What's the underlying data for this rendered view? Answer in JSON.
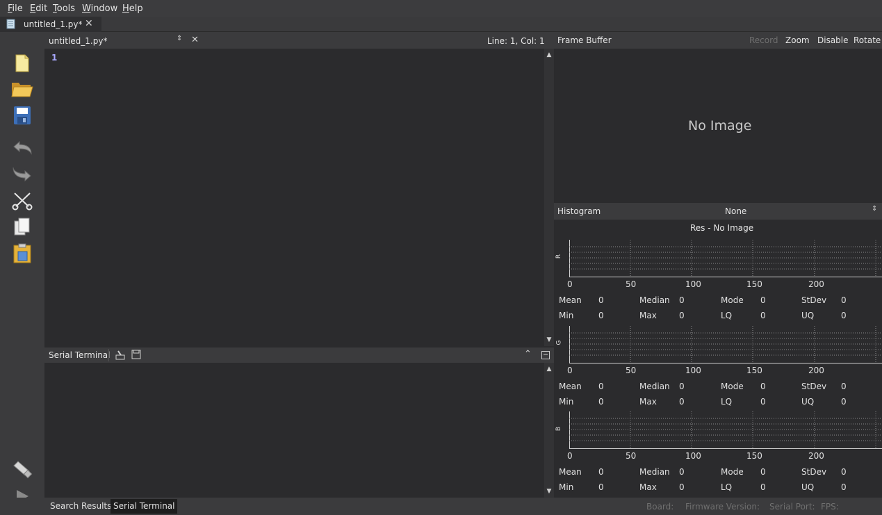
{
  "menu": [
    "File",
    "Edit",
    "Tools",
    "Window",
    "Help"
  ],
  "tab": {
    "title": "untitled_1.py*"
  },
  "editor": {
    "file_selector": "untitled_1.py*",
    "cursor_pos": "Line: 1, Col: 1",
    "line_numbers": [
      "1"
    ]
  },
  "toolbar": {
    "icons": [
      "new-file-icon",
      "open-folder-icon",
      "save-icon",
      "undo-icon",
      "redo-icon",
      "cut-icon",
      "copy-icon",
      "paste-icon",
      "connect-icon",
      "run-icon"
    ]
  },
  "terminal": {
    "title": "Serial Terminal"
  },
  "bottom_tabs": [
    "Search Results",
    "Serial Terminal"
  ],
  "status": {
    "board": "Board:",
    "firmware": "Firmware Version:",
    "serial_port": "Serial Port:",
    "fps": "FPS:"
  },
  "frame_buffer": {
    "title": "Frame Buffer",
    "buttons": [
      "Record",
      "Zoom",
      "Disable",
      "Rotate"
    ],
    "placeholder": "No Image"
  },
  "histogram": {
    "title": "Histogram",
    "mode": "None",
    "subtitle": "Res - No Image",
    "axis_ticks": [
      "0",
      "50",
      "100",
      "150",
      "200"
    ],
    "channels": [
      {
        "name": "R",
        "row1": [
          [
            "Mean",
            "0"
          ],
          [
            "Median",
            "0"
          ],
          [
            "Mode",
            "0"
          ],
          [
            "StDev",
            "0"
          ]
        ],
        "row2": [
          [
            "Min",
            "0"
          ],
          [
            "Max",
            "0"
          ],
          [
            "LQ",
            "0"
          ],
          [
            "UQ",
            "0"
          ]
        ]
      },
      {
        "name": "G",
        "row1": [
          [
            "Mean",
            "0"
          ],
          [
            "Median",
            "0"
          ],
          [
            "Mode",
            "0"
          ],
          [
            "StDev",
            "0"
          ]
        ],
        "row2": [
          [
            "Min",
            "0"
          ],
          [
            "Max",
            "0"
          ],
          [
            "LQ",
            "0"
          ],
          [
            "UQ",
            "0"
          ]
        ]
      },
      {
        "name": "B",
        "row1": [
          [
            "Mean",
            "0"
          ],
          [
            "Median",
            "0"
          ],
          [
            "Mode",
            "0"
          ],
          [
            "StDev",
            "0"
          ]
        ],
        "row2": [
          [
            "Min",
            "0"
          ],
          [
            "Max",
            "0"
          ],
          [
            "LQ",
            "0"
          ],
          [
            "UQ",
            "0"
          ]
        ]
      }
    ]
  },
  "colors": {
    "background": "#2b2b2d",
    "panel_header": "#3b3b3d",
    "line_number": "#a9a9ff",
    "disabled_text": "#6f6f6f"
  }
}
